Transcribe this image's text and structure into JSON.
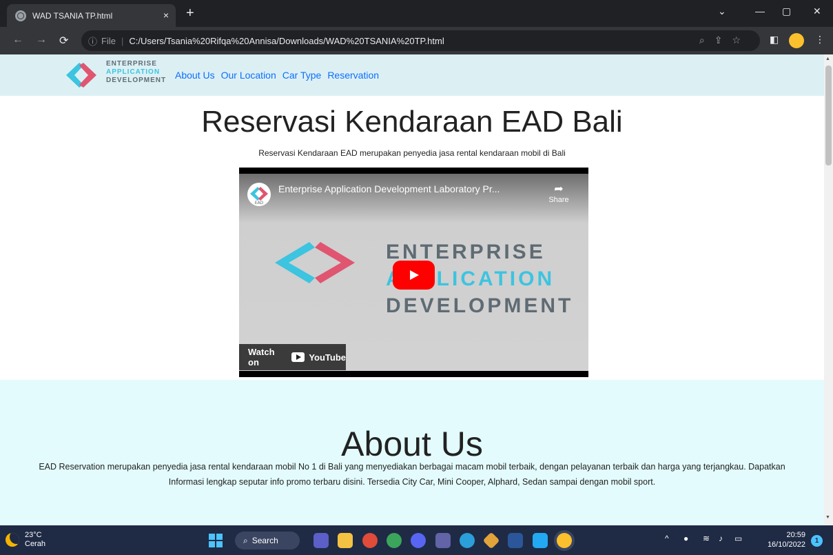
{
  "browser": {
    "tab_title": "WAD TSANIA TP.html",
    "tab_close": "×",
    "new_tab": "+",
    "address_prefix": "File",
    "address_url": "C:/Users/Tsania%20Rifqa%20Annisa/Downloads/WAD%20TSANIA%20TP.html"
  },
  "navbar": {
    "logo_lines": [
      "ENTERPRISE",
      "APPLICATION",
      "DEVELOPMENT"
    ],
    "links": [
      "About Us",
      "Our Location",
      "Car Type",
      "Reservation"
    ]
  },
  "hero": {
    "title": "Reservasi Kendaraan EAD Bali",
    "subtitle": "Reservasi Kendaraan EAD merupakan penyedia jasa rental kendaraan mobil di Bali"
  },
  "video": {
    "channel_label": "EAD",
    "title": "Enterprise Application Development Laboratory Pr...",
    "share_label": "Share",
    "thumb_lines": [
      "ENTERPRISE",
      "APPLICATION",
      "DEVELOPMENT"
    ],
    "watch_label": "Watch on",
    "platform": "YouTube"
  },
  "about": {
    "title": "About Us",
    "text": "EAD Reservation merupakan penyedia jasa rental kendaraan mobil No 1 di Bali yang menyediakan berbagai macam mobil terbaik, dengan pelayanan terbaik dan harga yang terjangkau. Dapatkan Informasi lengkap seputar info promo terbaru disini. Tersedia City Car, Mini Cooper, Alphard, Sedan sampai dengan mobil sport."
  },
  "taskbar": {
    "temperature": "23°C",
    "weather": "Cerah",
    "search_label": "Search",
    "time": "20:59",
    "date": "16/10/2022",
    "notification_count": "1"
  },
  "colors": {
    "navbar_bg": "#dcf0f4",
    "about_bg": "#e3fbfc",
    "link": "#0d6efd",
    "logo_cyan": "#3cc4e0",
    "logo_red": "#e05570"
  }
}
